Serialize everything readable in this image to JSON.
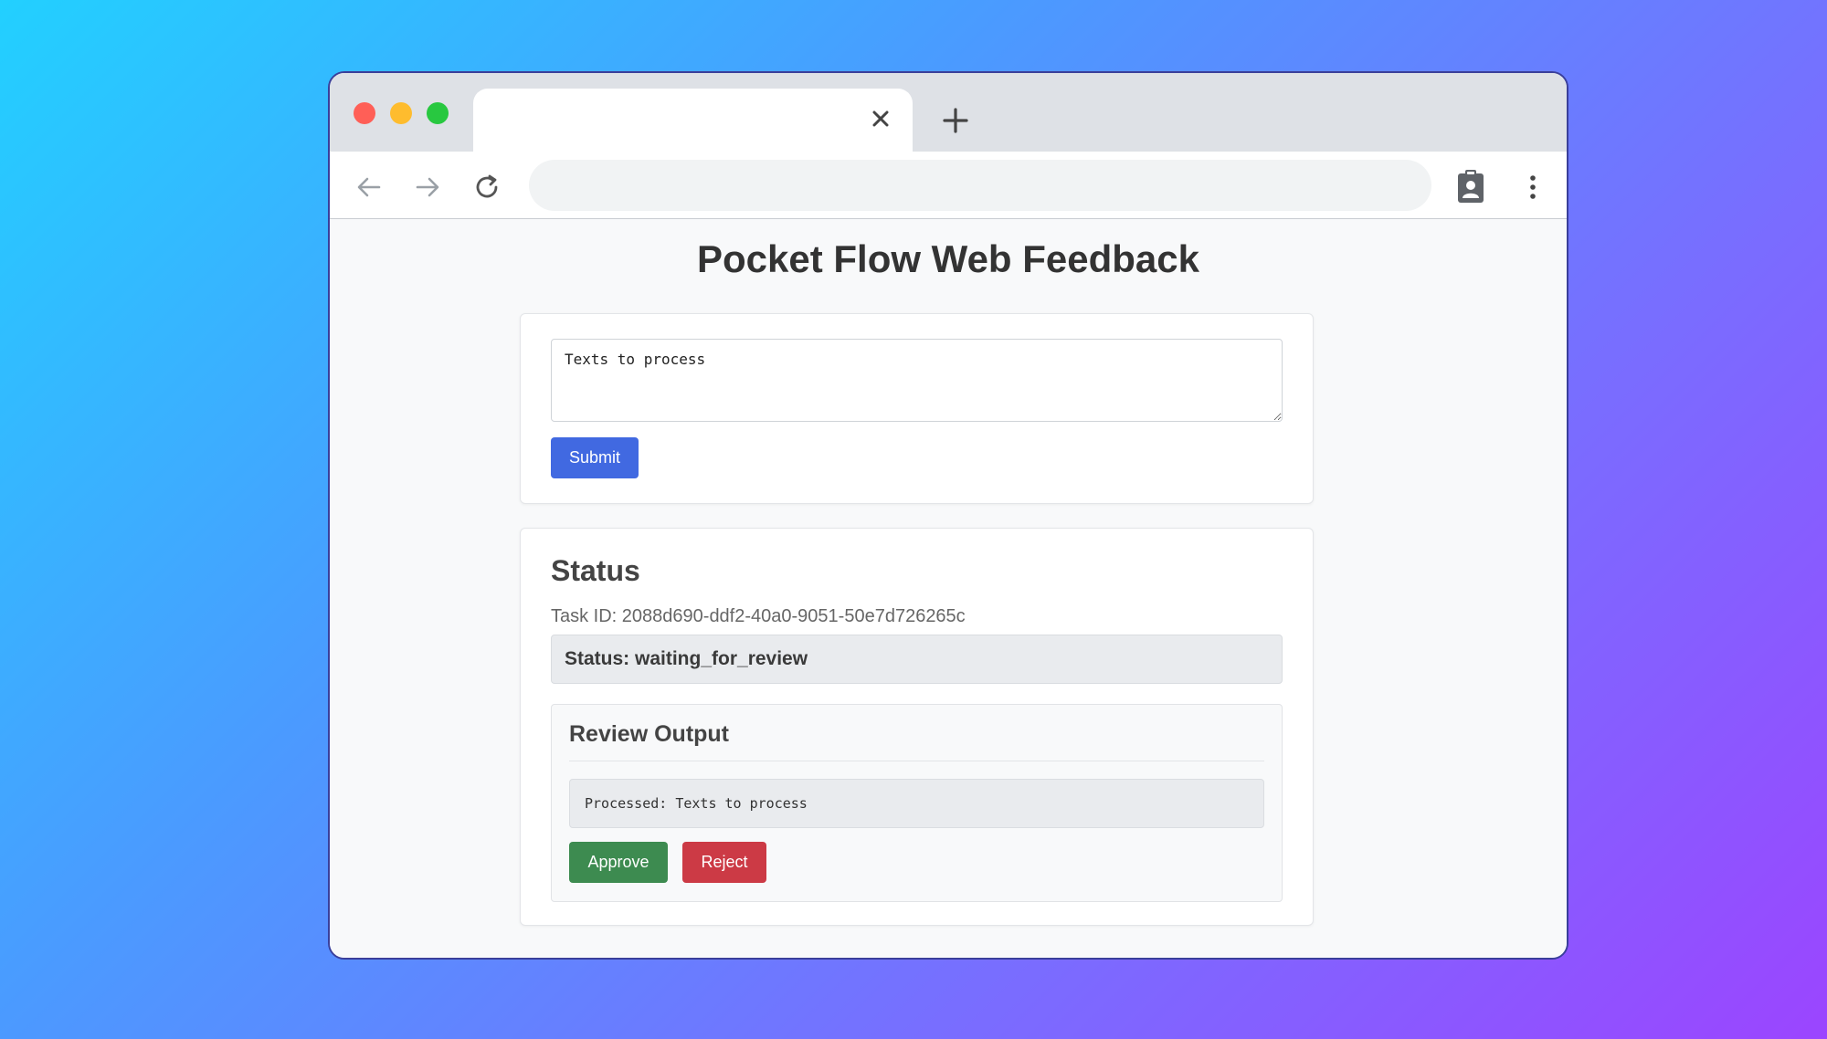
{
  "browser": {
    "tab_title": "",
    "address": ""
  },
  "page": {
    "title": "Pocket Flow Web Feedback"
  },
  "input_form": {
    "textarea_value": "Texts to process",
    "submit_label": "Submit"
  },
  "status": {
    "heading": "Status",
    "task_id": "Task ID: 2088d690-ddf2-40a0-9051-50e7d726265c",
    "status_text": "Status: waiting_for_review"
  },
  "review": {
    "heading": "Review Output",
    "output": "Processed: Texts to process",
    "approve_label": "Approve",
    "reject_label": "Reject"
  },
  "colors": {
    "submit": "#4169e1",
    "approve": "#3d8b50",
    "reject": "#cc3a45"
  },
  "icons": {
    "tab_close": "close-icon",
    "new_tab": "plus-icon",
    "back": "arrow-left-icon",
    "forward": "arrow-right-icon",
    "reload": "reload-icon",
    "profile": "clipboard-user-icon",
    "menu": "kebab-menu-icon"
  }
}
